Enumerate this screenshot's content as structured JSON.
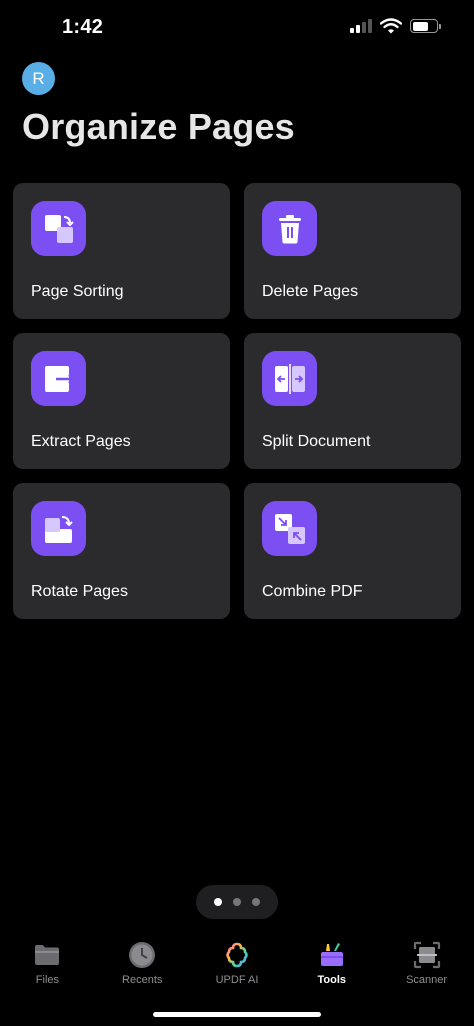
{
  "status_bar": {
    "time": "1:42"
  },
  "header": {
    "avatar_initial": "R",
    "title": "Organize Pages"
  },
  "colors": {
    "accent": "#7b4ff2",
    "card_bg": "#2b2b2d",
    "avatar_bg": "#5aaee6",
    "background": "#000000"
  },
  "tools": [
    {
      "label": "Page Sorting",
      "icon": "page-sorting-icon"
    },
    {
      "label": "Delete Pages",
      "icon": "trash-icon"
    },
    {
      "label": "Extract Pages",
      "icon": "extract-pages-icon"
    },
    {
      "label": "Split Document",
      "icon": "split-document-icon"
    },
    {
      "label": "Rotate Pages",
      "icon": "rotate-pages-icon"
    },
    {
      "label": "Combine PDF",
      "icon": "combine-pdf-icon"
    }
  ],
  "pagination": {
    "count": 3,
    "active_index": 0
  },
  "tab_bar": {
    "tabs": [
      {
        "label": "Files",
        "icon": "folder-icon"
      },
      {
        "label": "Recents",
        "icon": "clock-icon"
      },
      {
        "label": "UPDF AI",
        "icon": "updf-ai-icon"
      },
      {
        "label": "Tools",
        "icon": "toolbox-icon"
      },
      {
        "label": "Scanner",
        "icon": "scanner-icon"
      }
    ],
    "active": "Tools"
  }
}
